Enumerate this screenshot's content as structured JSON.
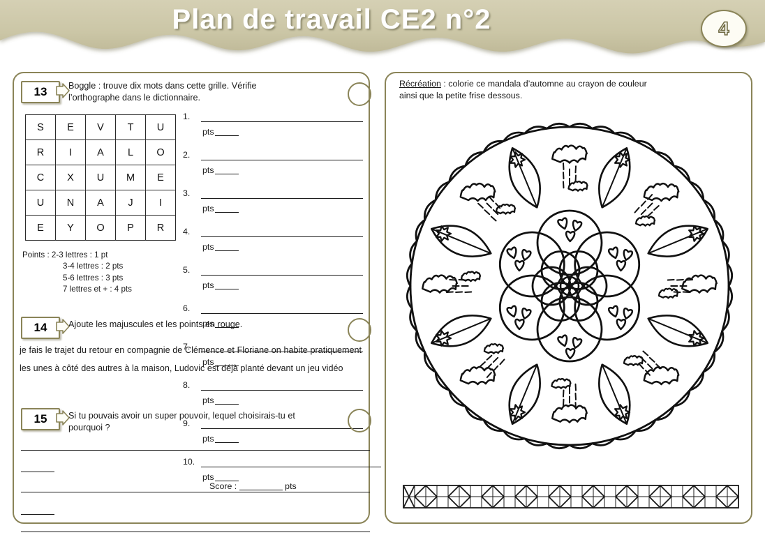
{
  "header": {
    "title": "Plan de travail CE2 n°2",
    "page_badge": "4"
  },
  "exercises": [
    {
      "number": "13",
      "instruction_line1": "Boggle :  trouve dix mots dans cette grille. Vérifie",
      "instruction_line2": "l’orthographe dans le dictionnaire."
    },
    {
      "number": "14",
      "instruction": "Ajoute les majuscules et les points en rouge.",
      "body": "je fais le trajet du retour en compagnie de Clémence et Floriane on habite pratiquement les unes à côté des autres à la maison, Ludovic est déjà planté devant un jeu vidéo"
    },
    {
      "number": "15",
      "instruction_line1": "Si tu pouvais avoir un super pouvoir, lequel choisirais-tu et",
      "instruction_line2": "pourquoi ?"
    }
  ],
  "boggle": {
    "grid": [
      [
        "S",
        "E",
        "V",
        "T",
        "U"
      ],
      [
        "R",
        "I",
        "A",
        "L",
        "O"
      ],
      [
        "C",
        "X",
        "U",
        "M",
        "E"
      ],
      [
        "U",
        "N",
        "A",
        "J",
        "I"
      ],
      [
        "E",
        "Y",
        "O",
        "P",
        "R"
      ]
    ],
    "points_label": "Points :",
    "points_rules": [
      "2-3 lettres : 1 pt",
      "3-4 lettres : 2 pts",
      "5-6 lettres : 3 pts",
      "7 lettres et + : 4 pts"
    ],
    "answer_numbers": [
      "1.",
      "2.",
      "3.",
      "4.",
      "5.",
      "6.",
      "7.",
      "8.",
      "9.",
      "10."
    ],
    "pts_label": "pts",
    "score_label": "Score :",
    "score_pts_label": "pts"
  },
  "recreation": {
    "title": "Récréation",
    "text_after_title": " : colorie ce mandala d’automne au crayon de couleur",
    "line2": "ainsi que la petite frise dessous."
  },
  "colors": {
    "accent": "#8a8458",
    "header_bg": "#cfcaac",
    "title_text": "#ffffff",
    "ink": "#1a1a1a"
  }
}
